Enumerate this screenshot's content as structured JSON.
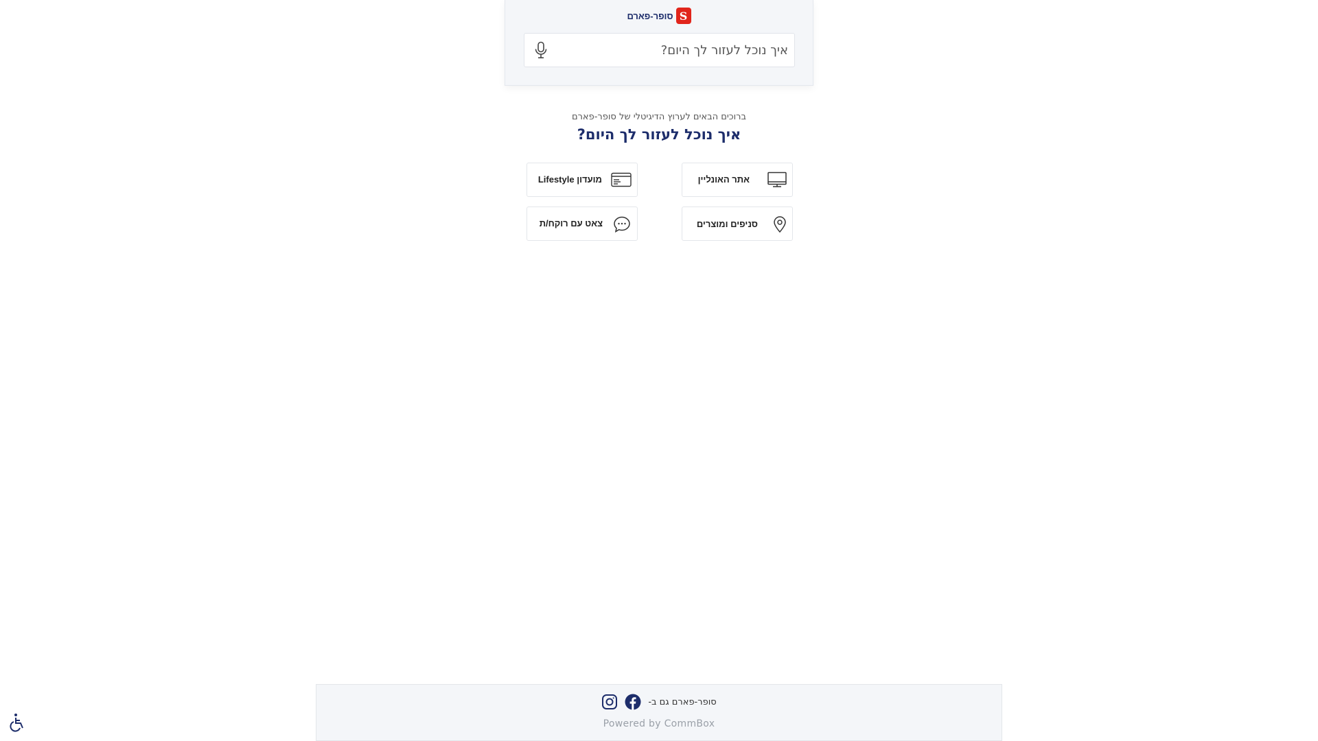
{
  "header": {
    "logo_text": "סופר-פארם",
    "logo_mark": "S",
    "search": {
      "placeholder": "איך נוכל לעזור לך היום?",
      "value": ""
    },
    "mic_icon": "microphone-icon"
  },
  "welcome": {
    "subtitle": "ברוכים הבאים לערוץ הדיגיטלי של סופר-פארם",
    "title": "איך נוכל לעזור לך היום?"
  },
  "actions": [
    {
      "label": "אתר האונליין",
      "icon": "monitor-icon"
    },
    {
      "label": "מועדון Lifestyle",
      "icon": "credit-card-icon"
    },
    {
      "label": "סניפים ומוצרים",
      "icon": "location-pin-icon"
    },
    {
      "label": "צאט עם רוקח/ת",
      "icon": "chat-bubble-icon"
    }
  ],
  "footer": {
    "social_text": "סופר-פארם גם ב-",
    "social_icons": [
      "facebook-icon",
      "instagram-icon"
    ],
    "powered_by": "Powered by CommBox"
  },
  "accessibility_icon": "wheelchair-icon",
  "colors": {
    "brand_red": "#e1251b",
    "brand_navy": "#1d2d6b",
    "facebook_blue": "#1d2d6b",
    "panel_bg": "#f4f6f9"
  }
}
